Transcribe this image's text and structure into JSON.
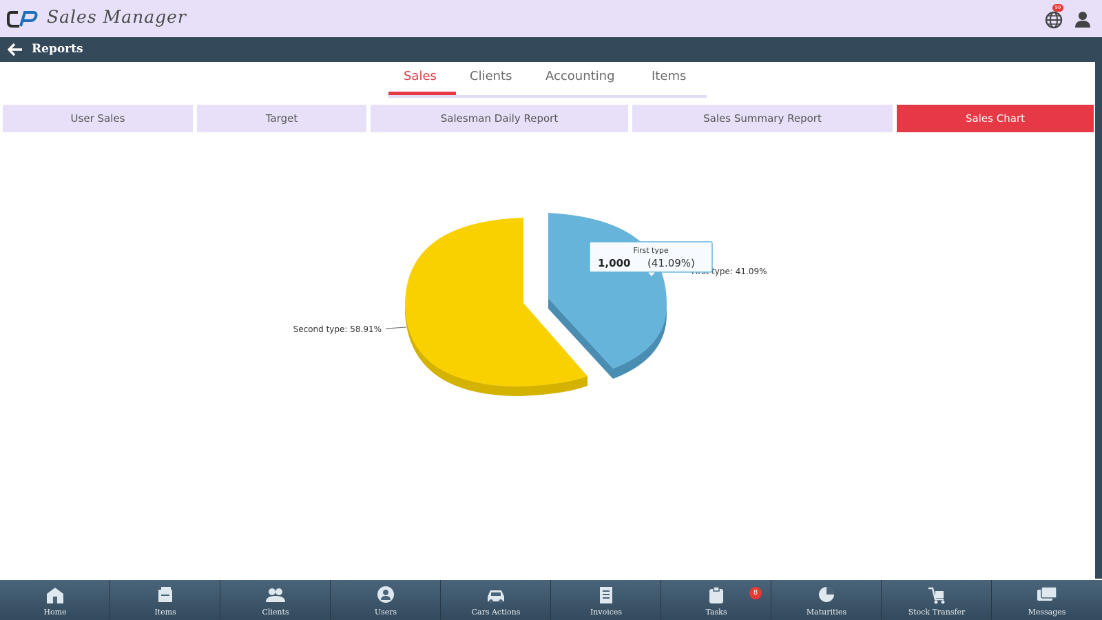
{
  "app": {
    "title": "Sales Manager",
    "notification_badge": "99"
  },
  "subheader": {
    "title": "Reports"
  },
  "tabs": [
    {
      "label": "Sales",
      "active": true
    },
    {
      "label": "Clients",
      "active": false
    },
    {
      "label": "Accounting",
      "active": false
    },
    {
      "label": "Items",
      "active": false
    }
  ],
  "subtabs": [
    {
      "label": "User Sales",
      "active": false
    },
    {
      "label": "Target",
      "active": false
    },
    {
      "label": "Salesman Daily Report",
      "active": false
    },
    {
      "label": "Sales Summary Report",
      "active": false
    },
    {
      "label": "Sales Chart",
      "active": true
    }
  ],
  "chart_data": {
    "type": "pie",
    "categories": [
      "First type",
      "Second type"
    ],
    "values": [
      41.09,
      58.91
    ],
    "colors": [
      "#66b4da",
      "#f9d100"
    ],
    "data_labels": [
      "First type: 41.09%",
      "Second type: 58.91%"
    ],
    "tooltip": {
      "title": "First type",
      "value": "1,000",
      "percent": "(41.09%)"
    },
    "style": "3d-exploded"
  },
  "bottom_nav": [
    {
      "label": "Home",
      "icon": "home-icon"
    },
    {
      "label": "Items",
      "icon": "items-icon"
    },
    {
      "label": "Clients",
      "icon": "clients-icon"
    },
    {
      "label": "Users",
      "icon": "users-icon"
    },
    {
      "label": "Cars Actions",
      "icon": "car-icon"
    },
    {
      "label": "Invoices",
      "icon": "invoice-icon"
    },
    {
      "label": "Tasks",
      "icon": "tasks-icon"
    },
    {
      "label": "Maturities",
      "icon": "maturities-icon"
    },
    {
      "label": "Stock Transfer",
      "icon": "stock-transfer-icon"
    },
    {
      "label": "Messages",
      "icon": "messages-icon"
    }
  ],
  "tasks_badge": "8",
  "colors": {
    "accent": "#e53945",
    "header_bg": "#e7e0f8",
    "dark_bar": "#34495a"
  }
}
